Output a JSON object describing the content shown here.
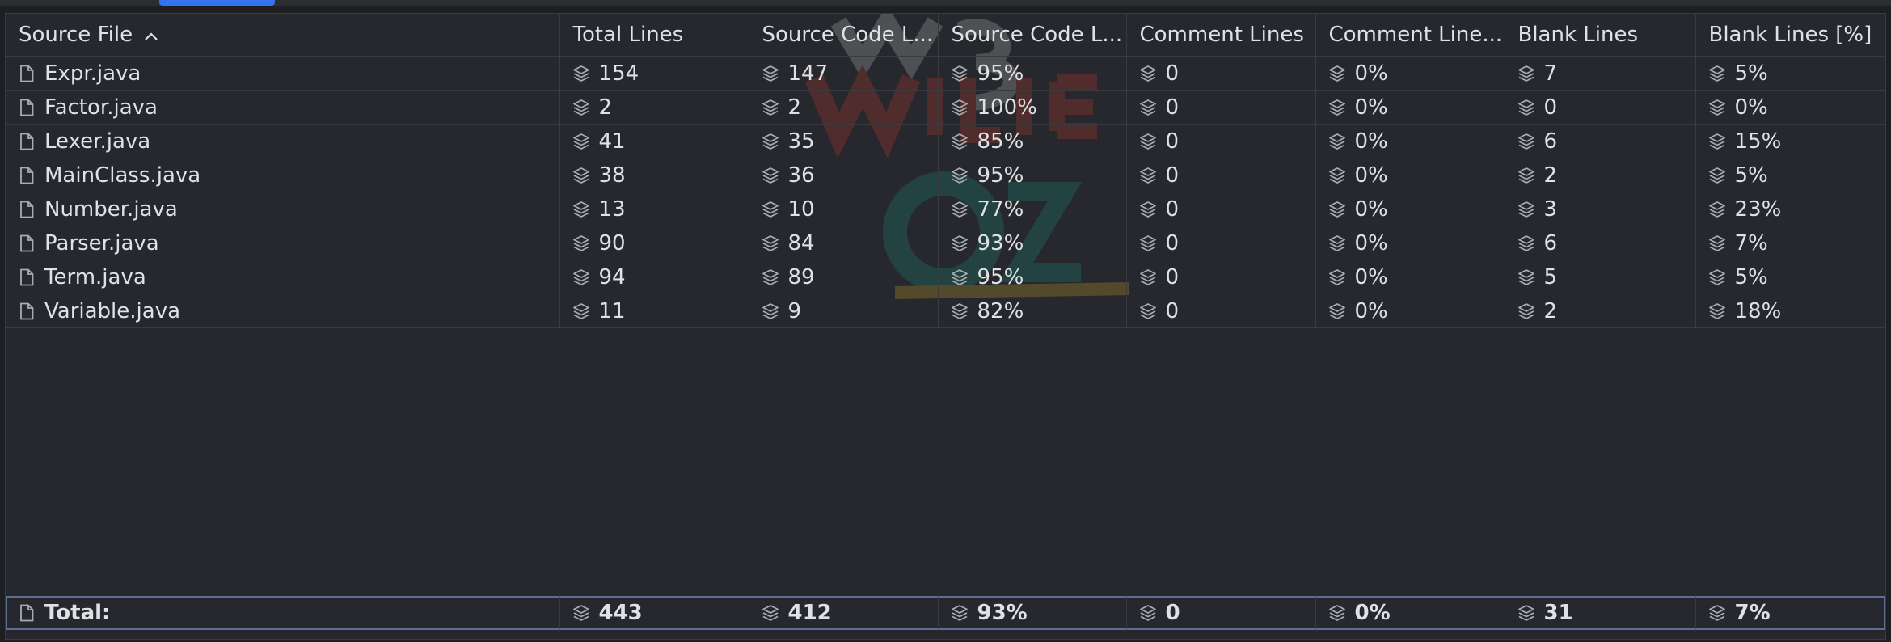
{
  "columns": [
    "Source File",
    "Total Lines",
    "Source Code L...",
    "Source Code L...",
    "Comment Lines",
    "Comment Line...",
    "Blank Lines",
    "Blank Lines [%]"
  ],
  "rows": [
    [
      "Expr.java",
      "154",
      "147",
      "95%",
      "0",
      "0%",
      "7",
      "5%"
    ],
    [
      "Factor.java",
      "2",
      "2",
      "100%",
      "0",
      "0%",
      "0",
      "0%"
    ],
    [
      "Lexer.java",
      "41",
      "35",
      "85%",
      "0",
      "0%",
      "6",
      "15%"
    ],
    [
      "MainClass.java",
      "38",
      "36",
      "95%",
      "0",
      "0%",
      "2",
      "5%"
    ],
    [
      "Number.java",
      "13",
      "10",
      "77%",
      "0",
      "0%",
      "3",
      "23%"
    ],
    [
      "Parser.java",
      "90",
      "84",
      "93%",
      "0",
      "0%",
      "6",
      "7%"
    ],
    [
      "Term.java",
      "94",
      "89",
      "95%",
      "0",
      "0%",
      "5",
      "5%"
    ],
    [
      "Variable.java",
      "11",
      "9",
      "82%",
      "0",
      "0%",
      "2",
      "18%"
    ]
  ],
  "total": [
    "Total:",
    "443",
    "412",
    "93%",
    "0",
    "0%",
    "31",
    "7%"
  ],
  "icons": {
    "file": "file-icon",
    "metric": "layers-icon",
    "sort": "chevron-up-icon"
  },
  "colors": {
    "background": "#1e1f22",
    "panel": "#26282d",
    "grid": "#393b40",
    "accent_tab": "#3574f0",
    "total_border": "#5c6f93",
    "text": "#dfe1e5",
    "icon": "#a9acb3"
  }
}
